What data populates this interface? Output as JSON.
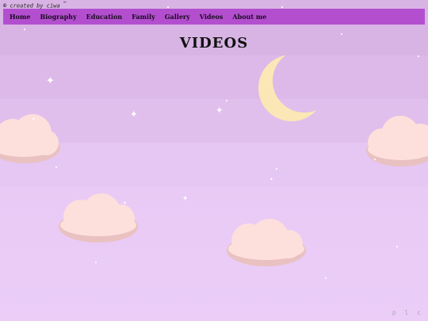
{
  "credit": {
    "symbol": "©",
    "by": "created by ciwa",
    "tm": "™"
  },
  "nav": {
    "items": [
      "Home",
      "Biography",
      "Education",
      "Family",
      "Gallery",
      "Videos",
      "About me"
    ]
  },
  "page": {
    "title": "VIDEOS"
  },
  "watermark": "p l c",
  "colors": {
    "nav_bg": "#b34fcf",
    "moon": "#fbe7b5",
    "cloud": "#fde0dc",
    "cloud_shadow": "#e9c1c0"
  }
}
